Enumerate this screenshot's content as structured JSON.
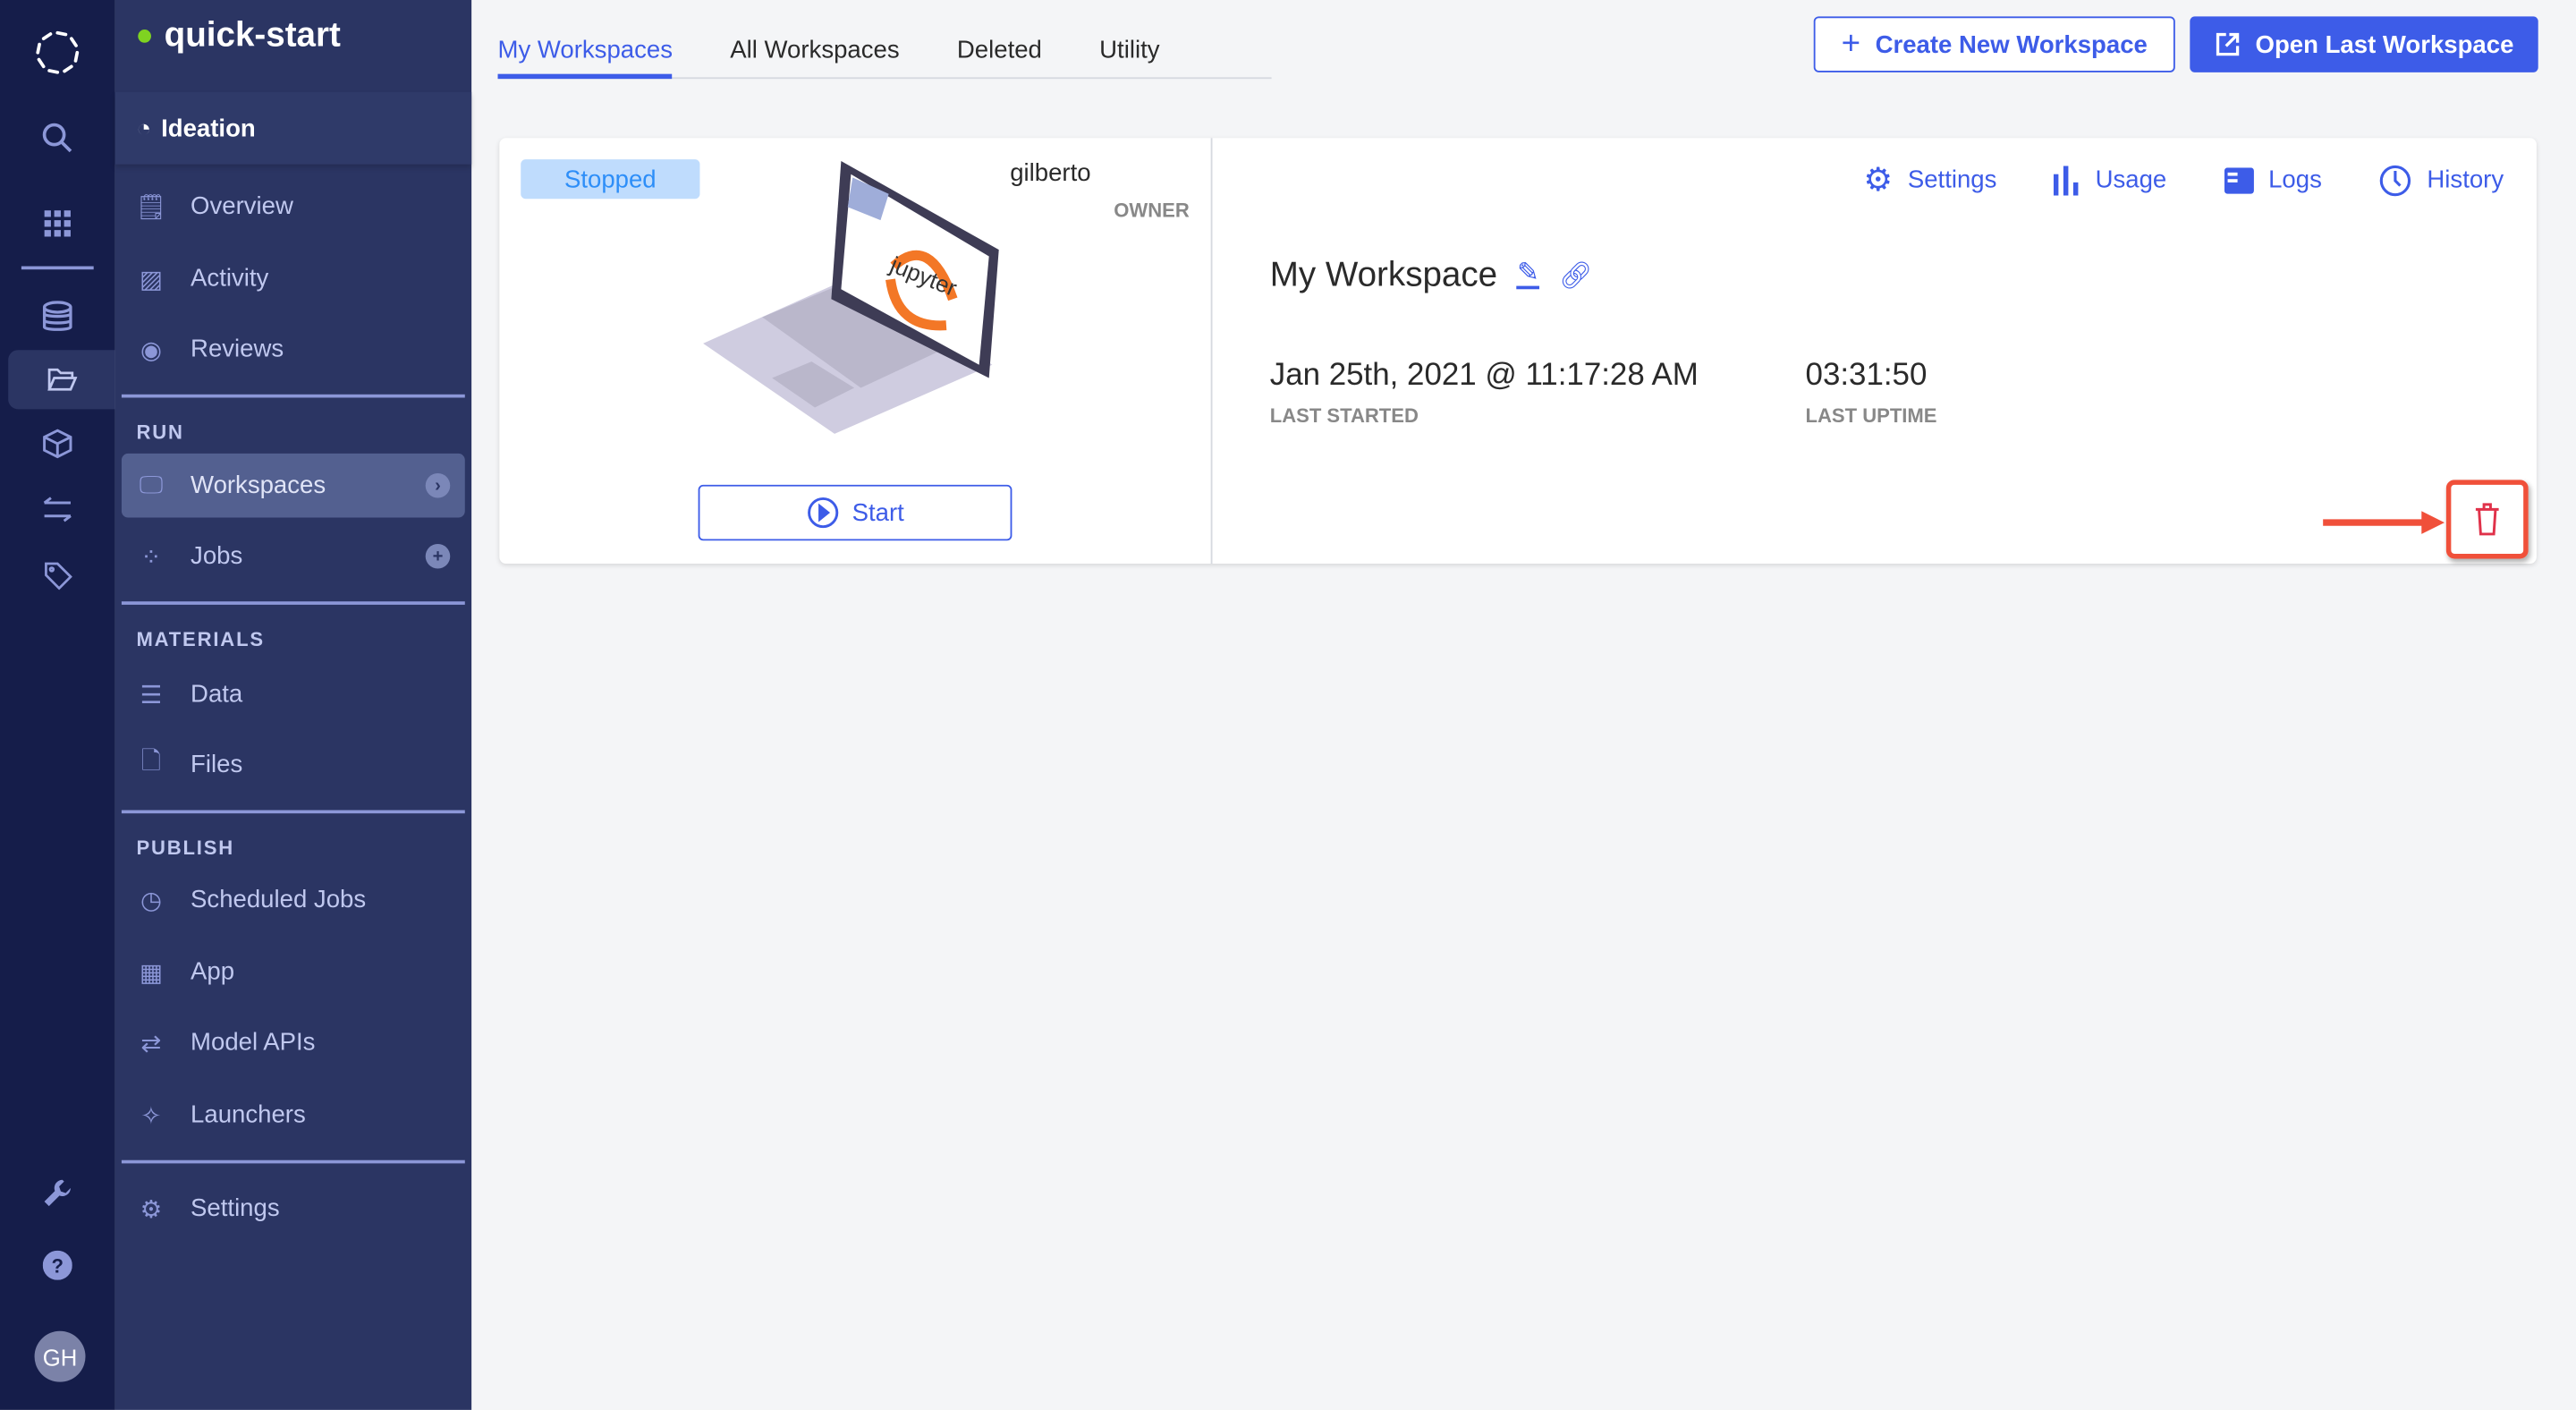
{
  "rail": {
    "icons": [
      "logo-icon",
      "search-icon",
      "apps-grid-icon",
      "database-icon",
      "folder-open-icon",
      "cube-icon",
      "transfer-icon",
      "tag-icon",
      "wrench-icon",
      "help-icon"
    ],
    "avatar": "GH"
  },
  "project": {
    "name": "quick-start",
    "status_color": "#7fd321",
    "stage": "Ideation"
  },
  "sidebar": {
    "items": [
      {
        "label": "Overview"
      },
      {
        "label": "Activity"
      },
      {
        "label": "Reviews"
      }
    ],
    "run": {
      "heading": "RUN",
      "items": [
        {
          "label": "Workspaces",
          "active": true
        },
        {
          "label": "Jobs"
        }
      ]
    },
    "materials": {
      "heading": "MATERIALS",
      "items": [
        {
          "label": "Data"
        },
        {
          "label": "Files"
        }
      ]
    },
    "publish": {
      "heading": "PUBLISH",
      "items": [
        {
          "label": "Scheduled Jobs"
        },
        {
          "label": "App"
        },
        {
          "label": "Model APIs"
        },
        {
          "label": "Launchers"
        }
      ]
    },
    "settings": "Settings"
  },
  "tabs": [
    {
      "label": "My Workspaces",
      "active": true
    },
    {
      "label": "All Workspaces"
    },
    {
      "label": "Deleted"
    },
    {
      "label": "Utility"
    }
  ],
  "actions": {
    "create": "Create New Workspace",
    "open_last": "Open Last Workspace"
  },
  "workspace": {
    "status": "Stopped",
    "owner": "gilberto",
    "owner_label": "OWNER",
    "start": "Start",
    "screen_logo": "jupyter",
    "links": [
      "Settings",
      "Usage",
      "Logs",
      "History"
    ],
    "name": "My Workspace",
    "last_started": "Jan 25th, 2021 @ 11:17:28 AM",
    "last_started_label": "LAST STARTED",
    "last_uptime": "03:31:50",
    "last_uptime_label": "LAST UPTIME"
  },
  "colors": {
    "accent": "#3d5ce8",
    "rail": "#151d4a",
    "sidebar": "#2b3563",
    "highlight": "#f0503a"
  }
}
